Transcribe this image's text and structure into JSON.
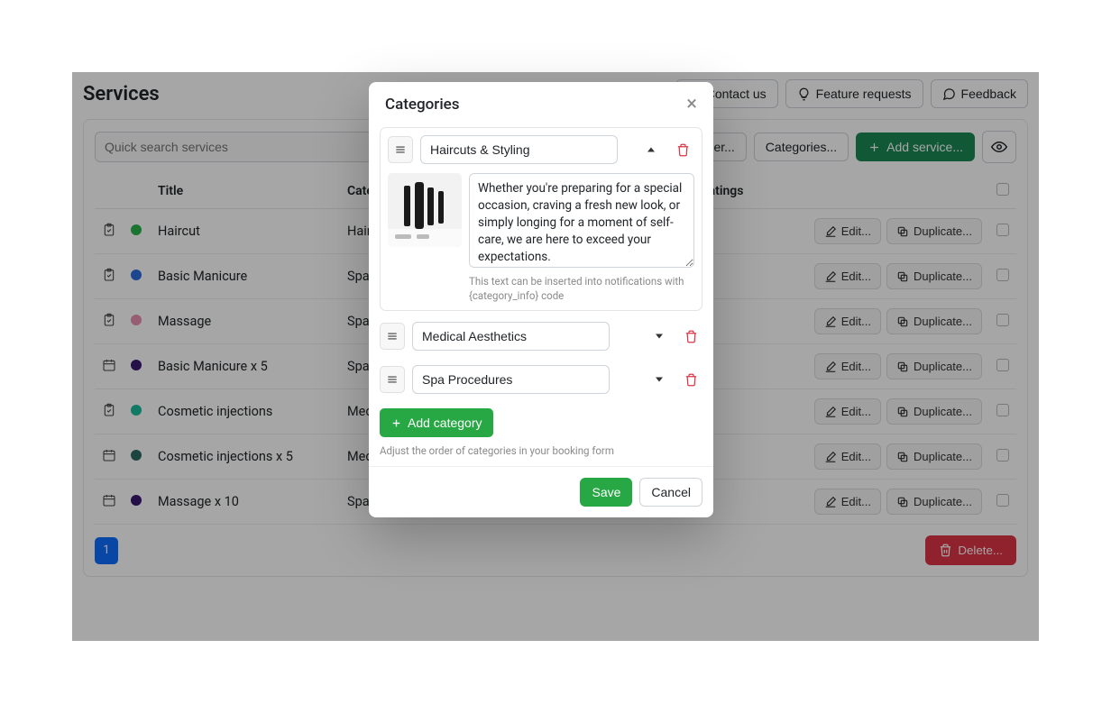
{
  "page": {
    "title": "Services",
    "contact": "Contact us",
    "feature": "Feature requests",
    "feedback": "Feedback"
  },
  "toolbar": {
    "search_placeholder": "Quick search services",
    "services_order": "Services order...",
    "categories": "Categories...",
    "add_service": "Add service..."
  },
  "table": {
    "headers": {
      "title": "Title",
      "category": "Category",
      "ratings": "Ratings"
    },
    "edit_label": "Edit...",
    "duplicate_label": "Duplicate...",
    "rows": [
      {
        "icon": "clipboard",
        "dot": "#2bb24c",
        "title": "Haircut",
        "category": "Haircuts & Styling"
      },
      {
        "icon": "clipboard",
        "dot": "#2d6cdf",
        "title": "Basic Manicure",
        "category": "Spa Procedures"
      },
      {
        "icon": "clipboard",
        "dot": "#e98fb0",
        "title": "Massage",
        "category": "Spa Procedures"
      },
      {
        "icon": "calendar",
        "dot": "#3a1a6f",
        "title": "Basic Manicure x 5",
        "category": "Spa Procedures"
      },
      {
        "icon": "clipboard",
        "dot": "#1abc9c",
        "title": "Cosmetic injections",
        "category": "Medical Aesthetics"
      },
      {
        "icon": "calendar",
        "dot": "#2b6b63",
        "title": "Cosmetic injections x 5",
        "category": "Medical Aesthetics"
      },
      {
        "icon": "calendar",
        "dot": "#3a1a6f",
        "title": "Massage x 10",
        "category": "Spa Procedures"
      }
    ]
  },
  "pager": {
    "current": "1"
  },
  "footer": {
    "delete": "Delete..."
  },
  "modal": {
    "title": "Categories",
    "description": "Whether you're preparing for a special occasion, craving a fresh new look, or simply longing for a moment of self-care, we are here to exceed your expectations.",
    "help": "This text can be inserted into notifications with {category_info} code",
    "add_label": "Add category",
    "order_hint": "Adjust the order of categories in your booking form",
    "save": "Save",
    "cancel": "Cancel",
    "categories": [
      {
        "name": "Haircuts & Styling",
        "expanded": true
      },
      {
        "name": "Medical Aesthetics",
        "expanded": false
      },
      {
        "name": "Spa Procedures",
        "expanded": false
      }
    ]
  }
}
